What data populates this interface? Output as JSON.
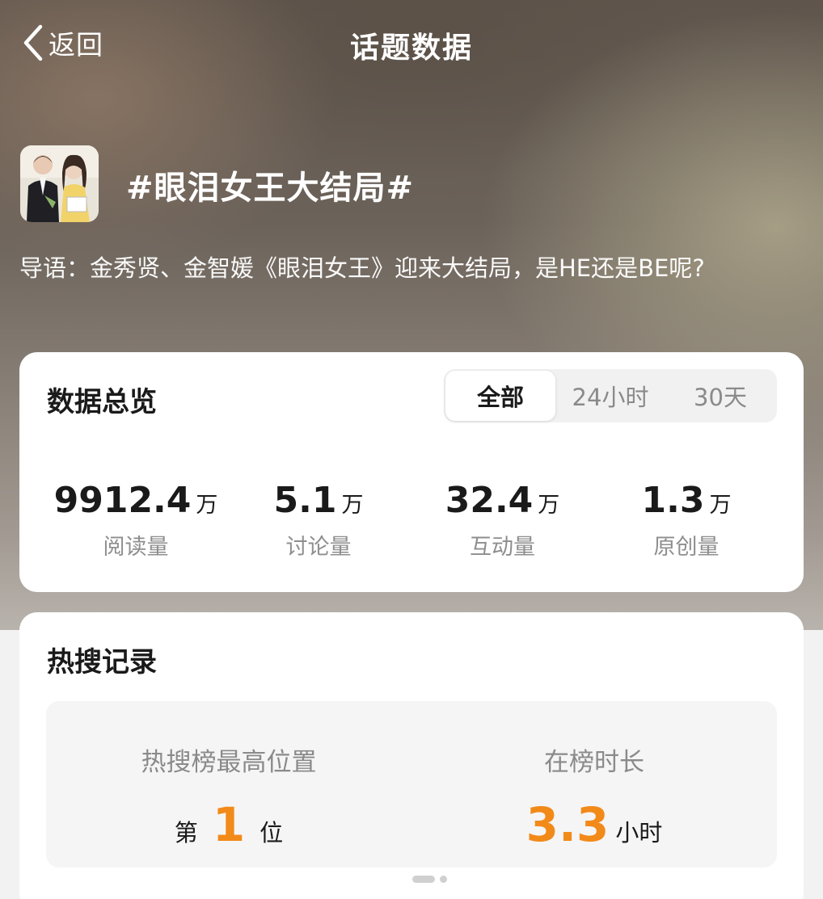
{
  "nav": {
    "back_label": "返回",
    "title": "话题数据"
  },
  "topic": {
    "title": "#眼泪女王大结局#",
    "intro": "导语：金秀贤、金智媛《眼泪女王》迎来大结局，是HE还是BE呢?"
  },
  "overview": {
    "title": "数据总览",
    "tabs": [
      {
        "label": "全部",
        "active": true
      },
      {
        "label": "24小时",
        "active": false
      },
      {
        "label": "30天",
        "active": false
      }
    ],
    "stats": [
      {
        "value": "9912.4",
        "unit": "万",
        "label": "阅读量"
      },
      {
        "value": "5.1",
        "unit": "万",
        "label": "讨论量"
      },
      {
        "value": "32.4",
        "unit": "万",
        "label": "互动量"
      },
      {
        "value": "1.3",
        "unit": "万",
        "label": "原创量"
      }
    ]
  },
  "hot_search": {
    "title": "热搜记录",
    "rank_label": "热搜榜最高位置",
    "rank_prefix": "第",
    "rank_value": "1",
    "rank_suffix": "位",
    "duration_label": "在榜时长",
    "duration_value": "3.3",
    "duration_unit": "小时"
  },
  "colors": {
    "accent": "#f28a1a",
    "card": "#ffffff"
  },
  "icons": {
    "back": "chevron-left-icon"
  }
}
